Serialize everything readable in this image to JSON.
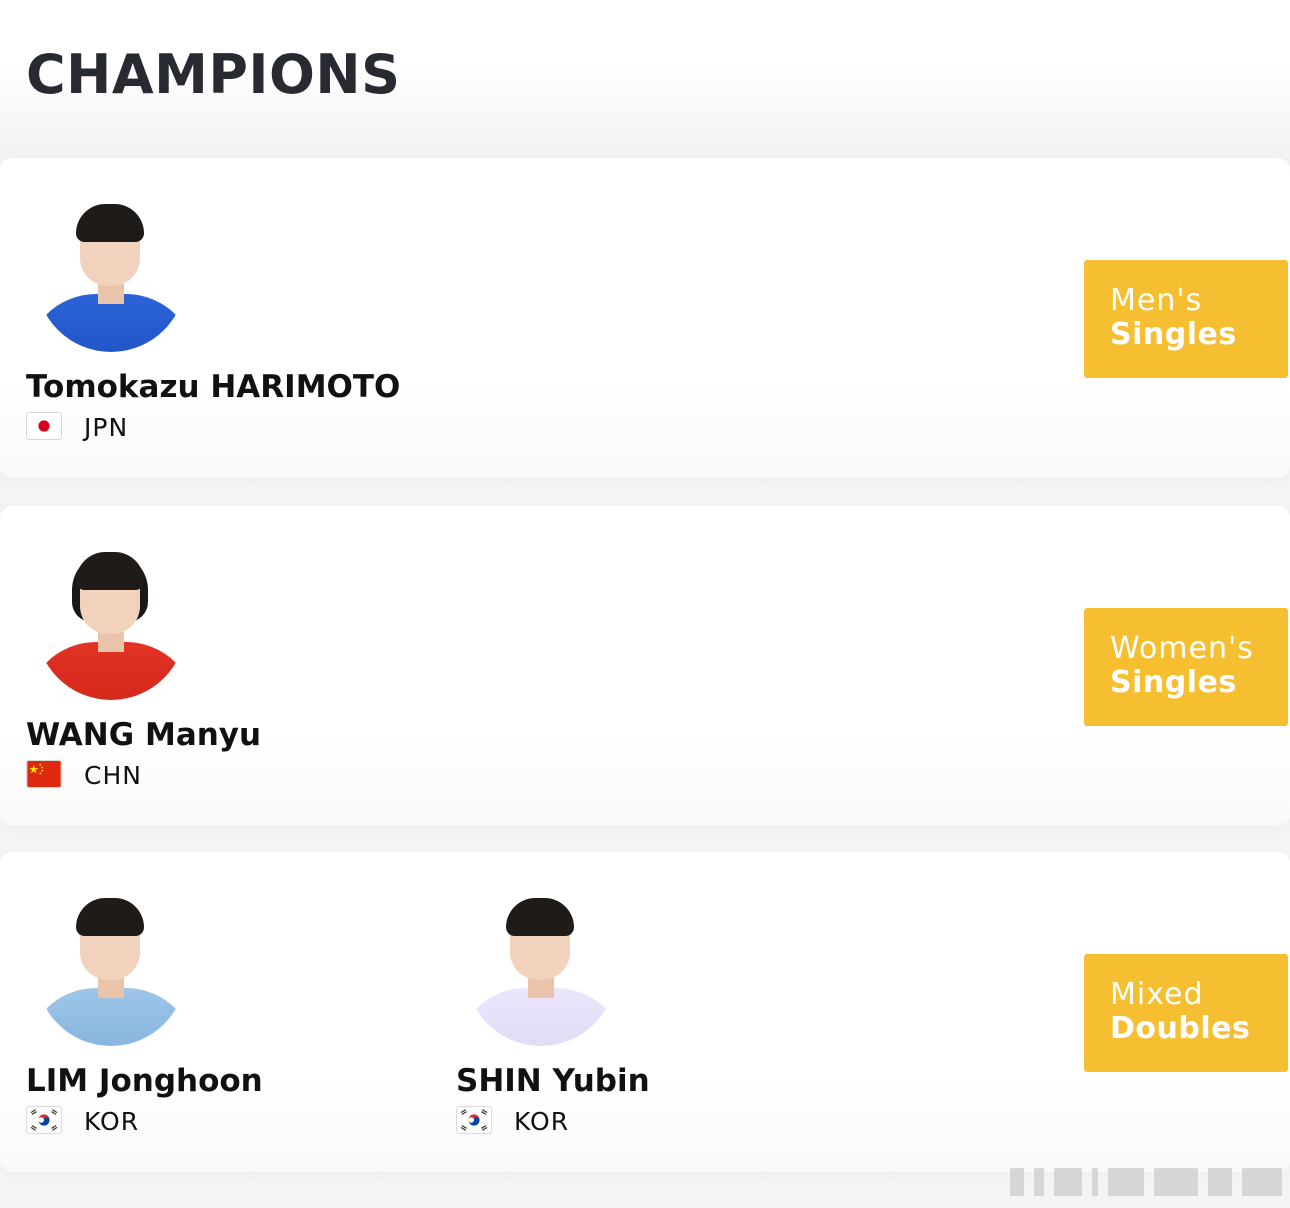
{
  "page": {
    "title": "CHAMPIONS"
  },
  "events": [
    {
      "event_line1": "Men's",
      "event_line2": "Singles",
      "players": [
        {
          "name": "Tomokazu HARIMOTO",
          "country": "JPN",
          "flag_icon": "japan-flag-icon",
          "photo_icon": "player-photo"
        }
      ]
    },
    {
      "event_line1": "Women's",
      "event_line2": "Singles",
      "players": [
        {
          "name": "WANG Manyu",
          "country": "CHN",
          "flag_icon": "china-flag-icon",
          "photo_icon": "player-photo"
        }
      ]
    },
    {
      "event_line1": "Mixed",
      "event_line2": "Doubles",
      "players": [
        {
          "name": "LIM Jonghoon",
          "country": "KOR",
          "flag_icon": "korea-flag-icon",
          "photo_icon": "player-photo"
        },
        {
          "name": "SHIN Yubin",
          "country": "KOR",
          "flag_icon": "korea-flag-icon",
          "photo_icon": "player-photo"
        }
      ]
    }
  ],
  "colors": {
    "badge": "#f5bf31",
    "title": "#272a30",
    "badge_text": "#ffffff",
    "japan_red": "#d7001f",
    "china_red": "#de2910",
    "china_yellow": "#ffde00",
    "korea_red": "#cd2e3a",
    "korea_blue": "#0047a0"
  }
}
